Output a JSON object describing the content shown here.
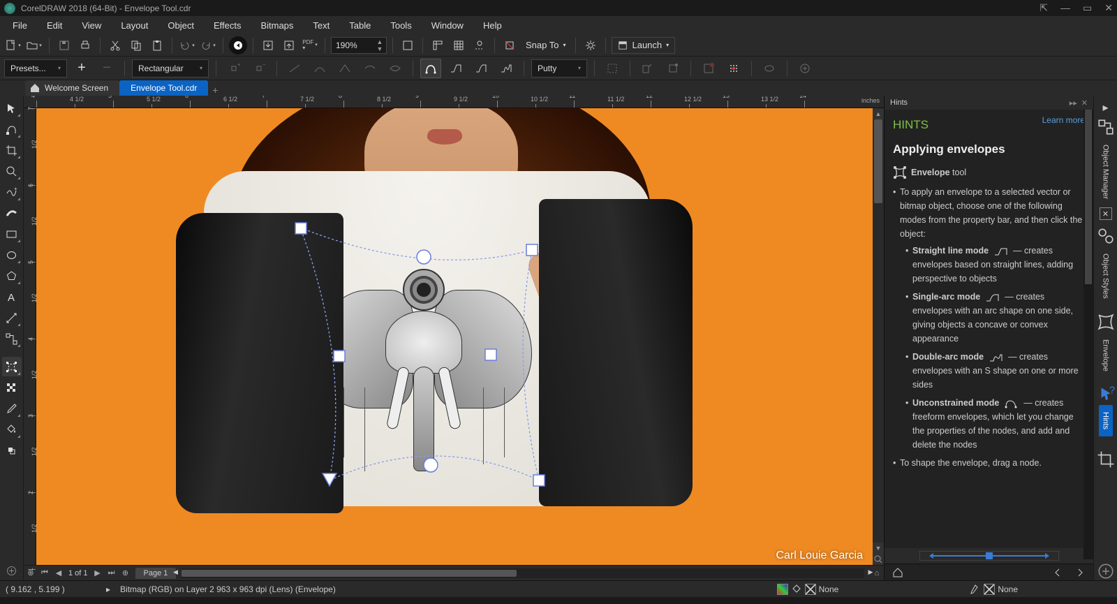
{
  "titlebar": {
    "title": "CorelDRAW 2018 (64-Bit) - Envelope Tool.cdr"
  },
  "menu": [
    "File",
    "Edit",
    "View",
    "Layout",
    "Object",
    "Effects",
    "Bitmaps",
    "Text",
    "Table",
    "Tools",
    "Window",
    "Help"
  ],
  "stdbar": {
    "zoom": "190%",
    "snap": "Snap To",
    "launch": "Launch"
  },
  "propbar": {
    "presets": "Presets...",
    "nodemode": "Rectangular",
    "mapping": "Putty"
  },
  "doctabs": {
    "welcome": "Welcome Screen",
    "active": "Envelope Tool.cdr"
  },
  "canvas": {
    "credit": "Carl Louie Garcia",
    "ruler_unit": "inches"
  },
  "pagenav": {
    "counter": "1  of  1",
    "page": "Page 1"
  },
  "docker": {
    "tab": "Hints",
    "heading": "HINTS",
    "learn": "Learn more",
    "title": "Applying envelopes",
    "tool_label_bold": "Envelope",
    "tool_label_rest": " tool",
    "intro": "To apply an envelope to a selected vector or bitmap object, choose one of the following modes from the property bar, and then click the object:",
    "modes": [
      {
        "name": "Straight line mode",
        "desc": "— creates envelopes based on straight lines, adding perspective to objects"
      },
      {
        "name": "Single-arc mode",
        "desc": "— creates envelopes with an arc shape on one side, giving objects a concave or convex appearance"
      },
      {
        "name": "Double-arc mode",
        "desc": "— creates envelopes with an S shape on one or more sides"
      },
      {
        "name": "Unconstrained mode",
        "desc": "— creates freeform envelopes, which let you change the properties of the nodes, and add and delete the nodes"
      }
    ],
    "note": "To shape the envelope, drag a node."
  },
  "tabstrip": [
    "Object Manager",
    "Object Styles",
    "Envelope",
    "Hints"
  ],
  "statusbar": {
    "coords": "( 9.162 , 5.199  )",
    "arrow": "▸",
    "info": "Bitmap (RGB) on Layer 2 963 x 963 dpi  (Lens) (Envelope)",
    "fill": "None",
    "outline": "None"
  }
}
